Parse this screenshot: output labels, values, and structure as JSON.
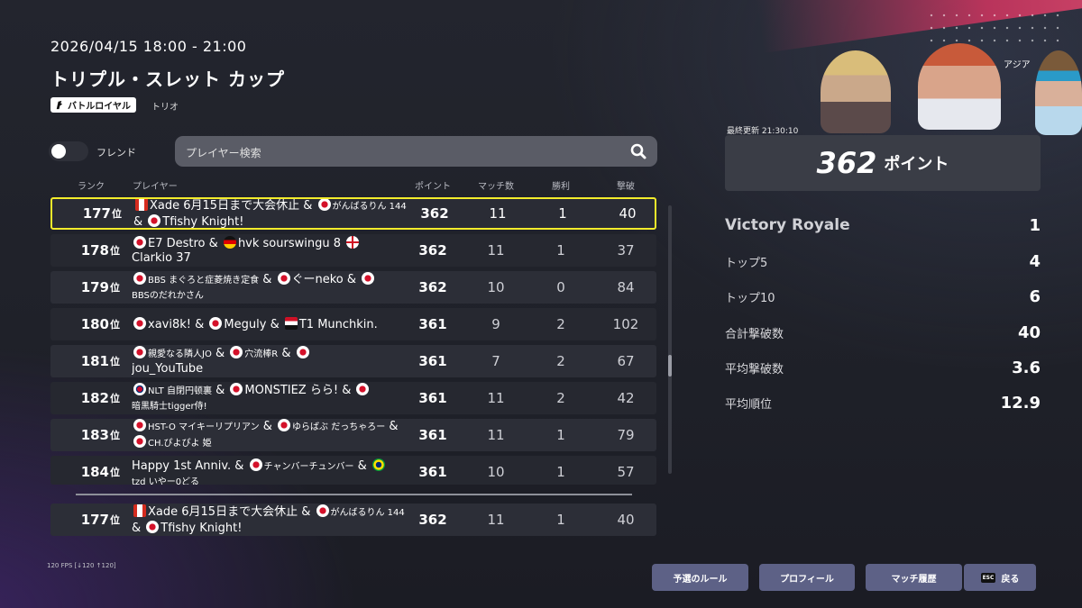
{
  "event": {
    "datetime": "2026/04/15 18:00 - 21:00",
    "title": "トリプル・スレット カップ",
    "mode_badge": "バトルロイヤル",
    "squad_type": "トリオ"
  },
  "filters": {
    "friend_label": "フレンド",
    "friend_toggle_on": false,
    "search_placeholder": "プレイヤー検索"
  },
  "table": {
    "headers": {
      "rank": "ランク",
      "player": "プレイヤー",
      "points": "ポイント",
      "matches": "マッチ数",
      "wins": "勝利",
      "elims": "撃破"
    },
    "rank_suffix": "位",
    "rows": [
      {
        "rank": "177",
        "p": [
          "Xade 6月15日まで大会休止",
          "がんばるりん 144",
          "Tfishy Knight!"
        ],
        "amp": "&",
        "points": "362",
        "matches": "11",
        "wins": "1",
        "elims": "40"
      },
      {
        "rank": "178",
        "p": [
          "E7 Destro",
          "hvk sourswingu 8",
          "Clarkio 37"
        ],
        "amp": "&",
        "points": "362",
        "matches": "11",
        "wins": "1",
        "elims": "37"
      },
      {
        "rank": "179",
        "p": [
          "BBS まぐろと症菱焼き定食",
          "ぐーneko",
          "BBSのだれかさん"
        ],
        "amp": "&",
        "points": "362",
        "matches": "10",
        "wins": "0",
        "elims": "84"
      },
      {
        "rank": "180",
        "p": [
          "xavi8k!",
          "Meguly",
          "T1 Munchkin."
        ],
        "amp": "&",
        "points": "361",
        "matches": "9",
        "wins": "2",
        "elims": "102"
      },
      {
        "rank": "181",
        "p": [
          "親愛なる隣人JO",
          "穴流棒R",
          "jou_YouTube"
        ],
        "amp": "&",
        "points": "361",
        "matches": "7",
        "wins": "2",
        "elims": "67"
      },
      {
        "rank": "182",
        "p": [
          "NLT 自閉円顿裏",
          "MONSTIEZ らら!",
          "暗黒騎士tigger侍!"
        ],
        "amp": "&",
        "points": "361",
        "matches": "11",
        "wins": "2",
        "elims": "42"
      },
      {
        "rank": "183",
        "p": [
          "HST-O マイキーリプリアン",
          "ゆらばぶ だっちゃろー",
          "CH.ぴよぴよ 姫"
        ],
        "amp": "&",
        "points": "361",
        "matches": "11",
        "wins": "1",
        "elims": "79"
      },
      {
        "rank": "184",
        "p": [
          "Happy 1st Anniv.",
          "チャンバーチュンバー",
          "tzd いやー0どる"
        ],
        "amp": "&",
        "points": "361",
        "matches": "10",
        "wins": "1",
        "elims": "57"
      }
    ],
    "self_row": {
      "rank": "177",
      "p": [
        "Xade 6月15日まで大会休止",
        "がんばるりん 144",
        "Tfishy Knight!"
      ],
      "amp": "&",
      "points": "362",
      "matches": "11",
      "wins": "1",
      "elims": "40"
    }
  },
  "summary": {
    "region": "アジア",
    "last_updated_label": "最終更新",
    "last_updated_time": "21:30:10",
    "points_value": "362",
    "points_label": "ポイント",
    "stats": [
      {
        "label": "Victory Royale",
        "value": "1"
      },
      {
        "label": "トップ5",
        "value": "4"
      },
      {
        "label": "トップ10",
        "value": "6"
      },
      {
        "label": "合計撃破数",
        "value": "40"
      },
      {
        "label": "平均撃破数",
        "value": "3.6"
      },
      {
        "label": "平均順位",
        "value": "12.9"
      }
    ]
  },
  "footer": {
    "fps": "120 FPS [↓120 ↑120]",
    "buttons": {
      "rules": "予選のルール",
      "profile": "プロフィール",
      "history": "マッチ履歴",
      "back": "戻る",
      "esc": "ESC"
    }
  },
  "colors": {
    "highlight": "#f3ec2b",
    "button": "#5d6186",
    "accent": "#c8345e"
  }
}
